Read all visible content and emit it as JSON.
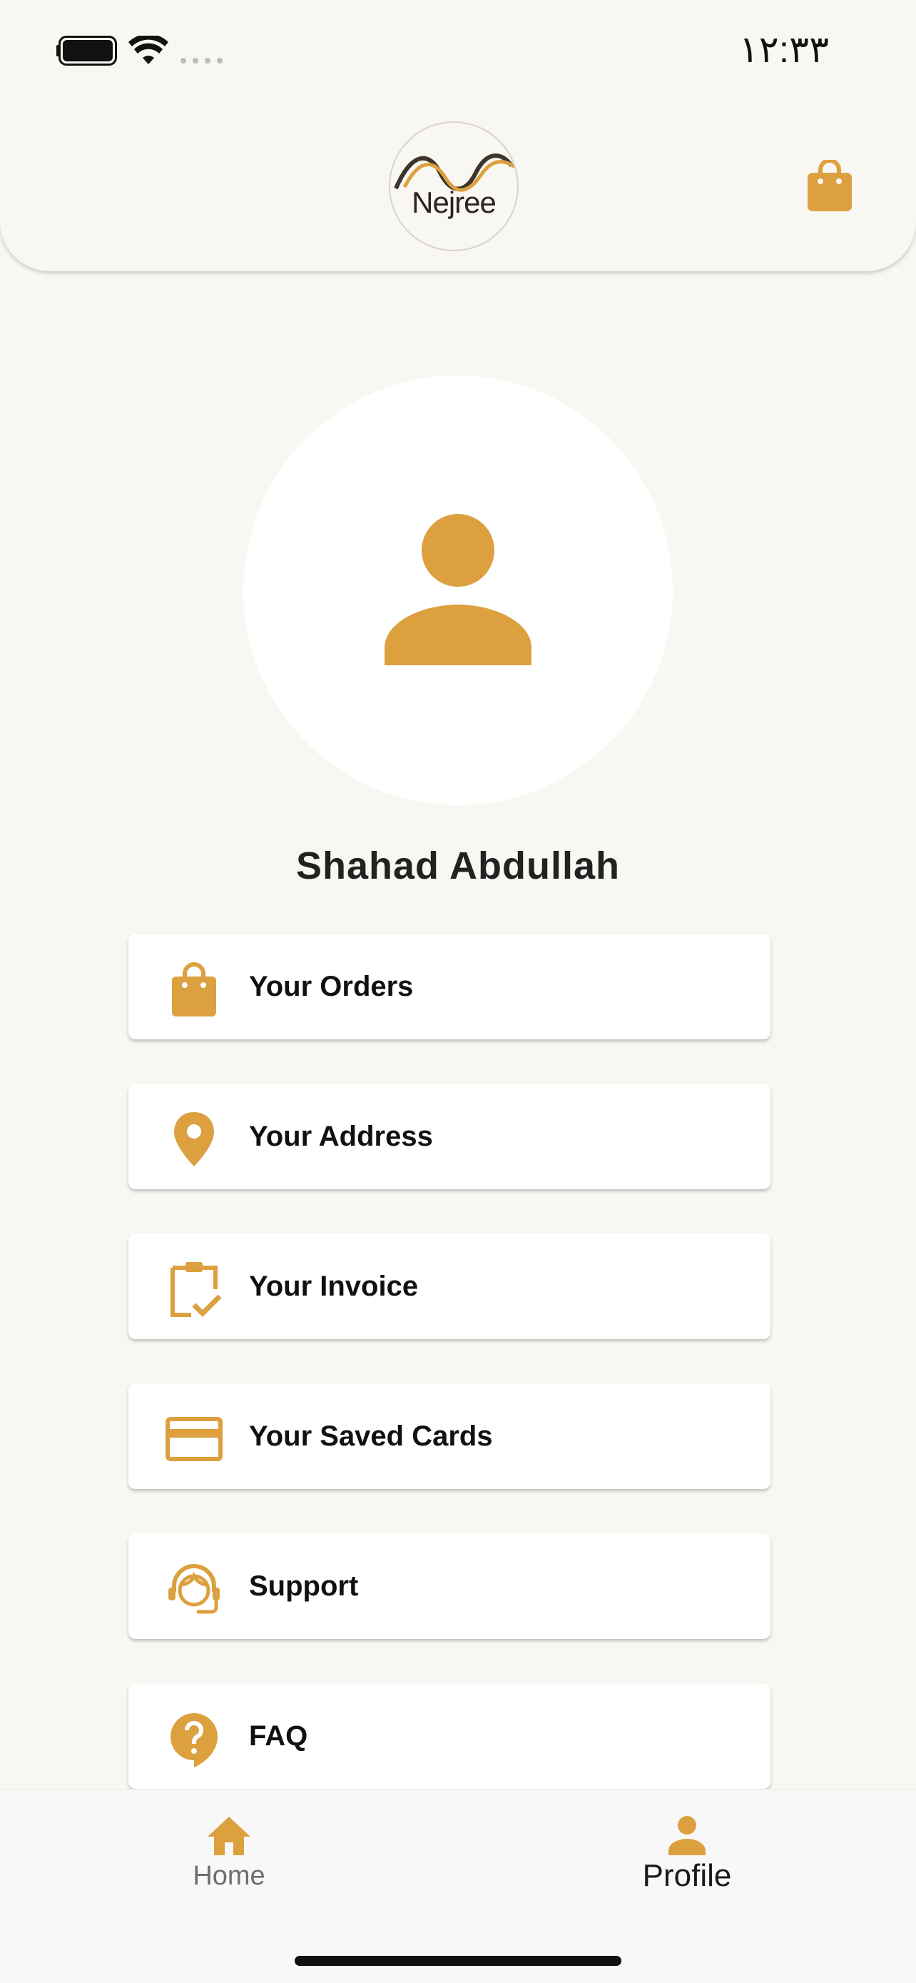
{
  "status_bar": {
    "time": "١٢:٣٣",
    "battery": "battery-full-icon",
    "wifi": "wifi-icon"
  },
  "header": {
    "logo_text": "Nejree",
    "cart_icon": "shopping-bag-icon"
  },
  "profile": {
    "avatar_icon": "person-icon",
    "name": "Shahad Abdullah"
  },
  "menu": {
    "items": [
      {
        "label": "Your Orders",
        "icon": "shopping-bag-icon"
      },
      {
        "label": "Your Address",
        "icon": "location-pin-icon"
      },
      {
        "label": "Your Invoice",
        "icon": "clipboard-check-icon"
      },
      {
        "label": "Your Saved Cards",
        "icon": "credit-card-icon"
      },
      {
        "label": "Support",
        "icon": "support-agent-icon"
      },
      {
        "label": "FAQ",
        "icon": "question-bubble-icon"
      }
    ]
  },
  "bottom_nav": {
    "items": [
      {
        "label": "Home",
        "icon": "home-icon",
        "active": false
      },
      {
        "label": "Profile",
        "icon": "person-icon",
        "active": true
      }
    ]
  },
  "colors": {
    "accent": "#DDA03F",
    "background": "#F9F7F1",
    "card": "#FFFFFF",
    "text": "#111111"
  }
}
